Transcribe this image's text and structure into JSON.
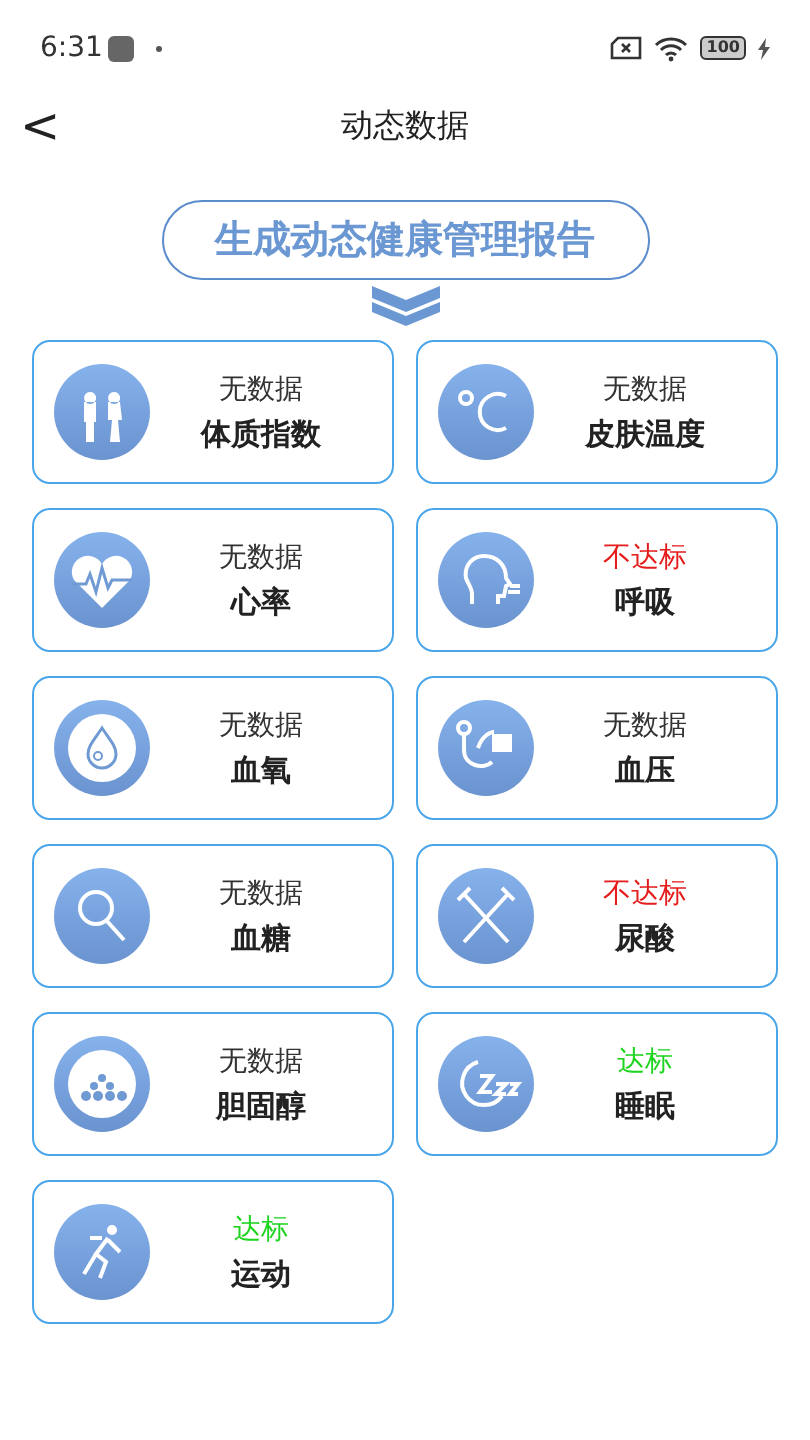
{
  "status_bar": {
    "time": "6:31",
    "battery": "100"
  },
  "header": {
    "back": "<",
    "title": "动态数据"
  },
  "report_button": {
    "label": "生成动态健康管理报告"
  },
  "metrics": [
    {
      "status": "无数据",
      "color": "#333333",
      "name": "体质指数"
    },
    {
      "status": "无数据",
      "color": "#333333",
      "name": "皮肤温度"
    },
    {
      "status": "无数据",
      "color": "#333333",
      "name": "心率"
    },
    {
      "status": "不达标",
      "color": "#e51c1c",
      "name": "呼吸"
    },
    {
      "status": "无数据",
      "color": "#333333",
      "name": "血氧"
    },
    {
      "status": "无数据",
      "color": "#333333",
      "name": "血压"
    },
    {
      "status": "无数据",
      "color": "#333333",
      "name": "血糖"
    },
    {
      "status": "不达标",
      "color": "#e51c1c",
      "name": "尿酸"
    },
    {
      "status": "无数据",
      "color": "#333333",
      "name": "胆固醇"
    },
    {
      "status": "达标",
      "color": "#1ed41e",
      "name": "睡眠"
    },
    {
      "status": "达标",
      "color": "#1ed41e",
      "name": "运动"
    }
  ]
}
